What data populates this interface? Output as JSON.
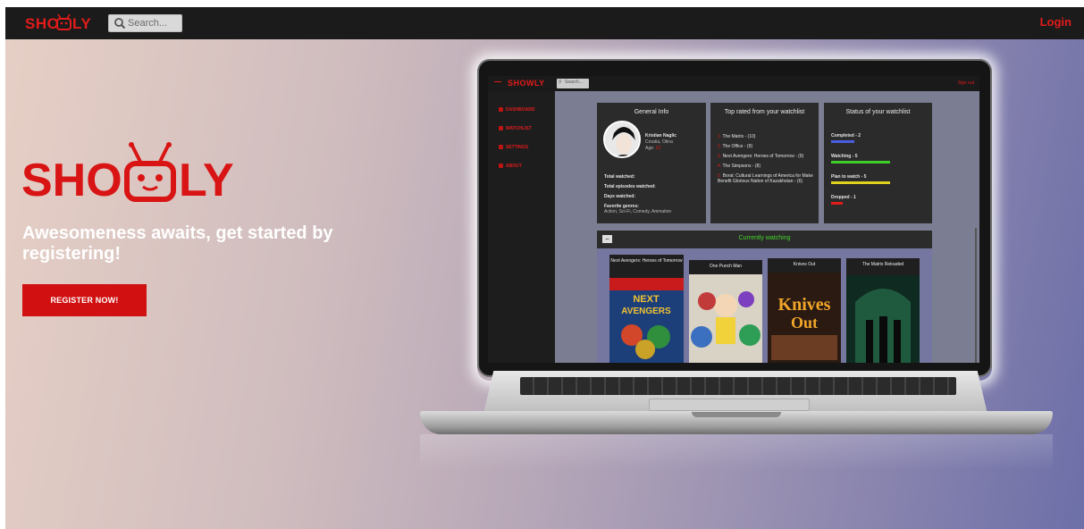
{
  "navbar": {
    "logo_text": "SHOWLY",
    "search_placeholder": "Search...",
    "login_label": "Login"
  },
  "hero": {
    "logo_text": "SHOWLY",
    "heading": "Awesomeness awaits, get started by registering!",
    "register_label": "REGISTER NOW!"
  },
  "screen": {
    "search_placeholder": "Search...",
    "login_label": "Sign out",
    "sidebar": [
      {
        "label": "DASHBOARD"
      },
      {
        "label": "WATCHLIST"
      },
      {
        "label": "SETTINGS"
      },
      {
        "label": "ABOUT"
      }
    ],
    "general_info": {
      "title": "General Info",
      "name": "Kristian Naglic",
      "location": "Croatia, Otina",
      "age_label": "Age:",
      "age_value": "22",
      "total_watched": "Total watched:",
      "total_episodes": "Total episodes watched:",
      "days_watched": "Days watched:",
      "favorite_genres_label": "Favorite genres:",
      "favorite_genres": "Action, Sci-Fi, Comedy, Animation"
    },
    "top_rated": {
      "title": "Top rated from your watchlist",
      "items": [
        "The Matrix - (10)",
        "The Office - (9)",
        "Next Avengers: Heroes of Tomorrow - (9)",
        "The Simpsons - (8)",
        "Borat: Cultural Learnings of America for Make Benefit Glorious Nation of Kazakhstan - (6)"
      ]
    },
    "status": {
      "title": "Status of your watchlist",
      "items": [
        {
          "label": "Completed - 2",
          "color": "#4a5de0",
          "fraction": 0.2
        },
        {
          "label": "Watching - 5",
          "color": "#3ecf2a",
          "fraction": 0.5
        },
        {
          "label": "Plan to watch - 5",
          "color": "#e0d21f",
          "fraction": 0.5
        },
        {
          "label": "Dropped - 1",
          "color": "#e21b1b",
          "fraction": 0.1
        }
      ]
    },
    "currently_watching": {
      "title": "Currently watching",
      "toggle_label": "−",
      "posters": [
        {
          "title": "Next Avengers: Heroes of Tomorrow"
        },
        {
          "title": "One Punch Man"
        },
        {
          "title": "Knives Out"
        },
        {
          "title": "The Matrix Reloaded"
        }
      ]
    }
  },
  "colors": {
    "brand_red": "#e21b1b",
    "navbar_bg": "#1b1b1b",
    "button_red": "#d11111"
  }
}
